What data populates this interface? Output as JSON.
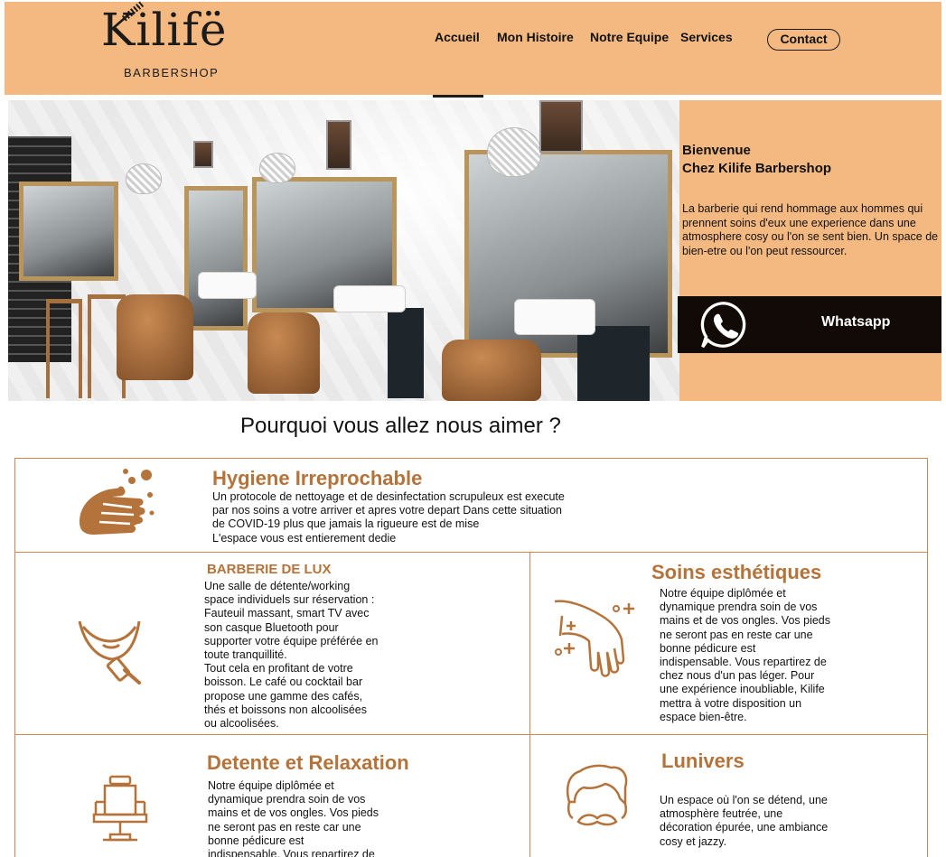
{
  "brand": {
    "logo_text": "Kilifë",
    "tagline": "BARBERSHOP"
  },
  "nav": {
    "items": [
      {
        "label": "Accueil",
        "active": true
      },
      {
        "label": "Mon Histoire",
        "active": false
      },
      {
        "label": "Notre Equipe",
        "active": false
      },
      {
        "label": "Services",
        "active": false
      }
    ],
    "contact_label": "Contact"
  },
  "hero": {
    "welcome_line1": "Bienvenue",
    "welcome_line2": "Chez Kilife Barbershop",
    "description": "La barberie qui rend hommage aux hommes qui prennent soins d'eux une experience dans une atmosphere cosy ou l'on se sent bien. Un space de bien-etre ou l'on peut ressourcer.",
    "whatsapp_label": "Whatsapp"
  },
  "section": {
    "title": "Pourquoi vous allez nous aimer ?"
  },
  "features": {
    "hygiene": {
      "title": "Hygiene Irreprochable",
      "lines": [
        "Un protocole de nettoyage et de desinfectation scrupuleux est execute",
        "par nos soins a votre arriver et apres votre depart Dans cette situation",
        "de COVID-19 plus que jamais la rigueure est de mise",
        "L'espace vous est entierement dedie"
      ]
    },
    "barberie": {
      "title": "BARBERIE DE LUX",
      "lines": [
        "Une salle de détente/working",
        "space individuels sur réservation :",
        "Fauteuil massant, smart TV avec",
        "son casque Bluetooth pour",
        "supporter votre équipe préférée en",
        "toute tranquillité.",
        "Tout cela en profitant de votre",
        "boisson. Le café ou cocktail bar",
        "propose une gamme des cafés,",
        "thés et boissons non alcoolisées",
        "ou alcoolisées."
      ]
    },
    "soins": {
      "title": "Soins esthétiques",
      "lines": [
        "Notre équipe diplômée et",
        "dynamique prendra soin de vos",
        "mains et de vos ongles. Vos pieds",
        "ne seront pas en reste car une",
        "bonne pédicure est",
        "indispensable. Vous repartirez de",
        "chez nous d'un pas léger. Pour",
        "une expérience inoubliable, Kilife",
        "mettra à votre disposition un",
        "espace bien-être."
      ]
    },
    "detente": {
      "title": "Detente et Relaxation",
      "lines": [
        "Notre équipe diplômée et",
        "dynamique prendra soin de vos",
        "mains et de vos ongles. Vos pieds",
        "ne seront pas en reste car une",
        "bonne pédicure est",
        "indispensable. Vous repartirez de"
      ]
    },
    "lunivers": {
      "title": "Lunivers",
      "lines": [
        "Un espace où l'on se détend, une",
        "atmosphère feutrée, une",
        "décoration épurée, une ambiance",
        "cosy et jazzy."
      ]
    }
  },
  "colors": {
    "header_bg": "#f4b881",
    "accent": "#b4733a",
    "dark": "#120a07",
    "line": "#c9874f"
  }
}
